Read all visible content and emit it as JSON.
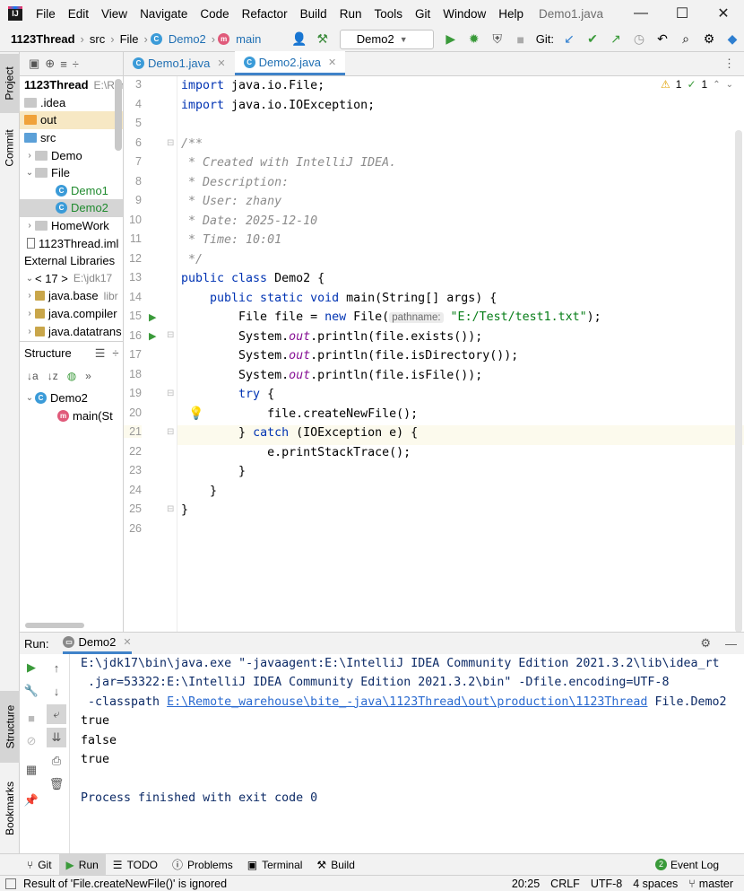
{
  "menubar": {
    "items": [
      "File",
      "Edit",
      "View",
      "Navigate",
      "Code",
      "Refactor",
      "Build",
      "Run",
      "Tools",
      "Git",
      "Window",
      "Help"
    ],
    "title": "Demo1.java"
  },
  "navbar": {
    "crumbs": [
      "1123Thread",
      "src",
      "File",
      "Demo2",
      "main"
    ],
    "run_config": "Demo2",
    "git_label": "Git:"
  },
  "side_tabs": {
    "project": "Project",
    "commit": "Commit",
    "structure": "Structure",
    "bookmarks": "Bookmarks"
  },
  "project_tree": {
    "rows": [
      {
        "label": "1123Thread",
        "extra": "E:\\Ren",
        "kind": "root"
      },
      {
        "label": ".idea",
        "kind": "folder-grey"
      },
      {
        "label": "out",
        "kind": "folder-orange"
      },
      {
        "label": "src",
        "kind": "folder-blue"
      },
      {
        "label": "Demo",
        "kind": "folder-grey"
      },
      {
        "label": "File",
        "kind": "folder-grey"
      },
      {
        "label": "Demo1",
        "kind": "class"
      },
      {
        "label": "Demo2",
        "kind": "class"
      },
      {
        "label": "HomeWork",
        "kind": "folder-grey"
      },
      {
        "label": "1123Thread.iml",
        "kind": "file"
      },
      {
        "label": "External Libraries",
        "kind": "lib"
      },
      {
        "label": "< 17 >",
        "extra": "E:\\jdk17",
        "kind": "lib"
      },
      {
        "label": "java.base",
        "extra": "libr",
        "kind": "jar"
      },
      {
        "label": "java.compiler",
        "kind": "jar"
      },
      {
        "label": "java.datatrans",
        "kind": "jar"
      }
    ]
  },
  "structure": {
    "title": "Structure",
    "class_name": "Demo2",
    "method": "main(St"
  },
  "editor": {
    "tabs": [
      "Demo1.java",
      "Demo2.java"
    ],
    "warnings": "1",
    "checks": "1",
    "line_numbers": [
      "3",
      "4",
      "5",
      "6",
      "7",
      "8",
      "9",
      "10",
      "11",
      "12",
      "13",
      "14",
      "15",
      "16",
      "17",
      "18",
      "19",
      "20",
      "21",
      "22",
      "23",
      "24",
      "25",
      "26"
    ],
    "lines": {
      "l3a": "import",
      "l3b": " java.io.File;",
      "l4a": "import",
      "l4b": " java.io.IOException;",
      "l6": "/**",
      "l7": " * Created with IntelliJ IDEA.",
      "l8": " * Description:",
      "l9": " * User: zhany",
      "l10": " * Date: 2025-12-10",
      "l11": " * Time: 10:01",
      "l12": " */",
      "l13a": "public class",
      "l13b": " Demo2 {",
      "l14a": "    public static void",
      "l14b": " main(String[] args) {",
      "l15a": "        File file = ",
      "l15b": "new",
      "l15c": " File(",
      "l15hint": "pathname:",
      "l15d": " \"E:/Test/test1.txt\"",
      "l15e": ");",
      "l16a": "        System.",
      "l16b": "out",
      "l16c": ".println(file.exists());",
      "l17a": "        System.",
      "l17b": "out",
      "l17c": ".println(file.isDirectory());",
      "l18a": "        System.",
      "l18b": "out",
      "l18c": ".println(file.isFile());",
      "l19a": "        try",
      "l19b": " {",
      "l20": "            file.createNewFile();",
      "l21a": "        } ",
      "l21b": "catch",
      "l21c": " (IOException e) {",
      "l22": "            e.printStackTrace();",
      "l23": "        }",
      "l24": "    }",
      "l25": "}"
    }
  },
  "run_panel": {
    "label": "Run:",
    "tab": "Demo2",
    "console": {
      "line1": "E:\\jdk17\\bin\\java.exe \"-javaagent:E:\\IntelliJ IDEA Community Edition 2021.3.2\\lib\\idea_rt",
      "line2": " .jar=53322:E:\\IntelliJ IDEA Community Edition 2021.3.2\\bin\" -Dfile.encoding=UTF-8",
      "line3a": " -classpath ",
      "line3b": "E:\\Remote_warehouse\\bite_-java\\1123Thread\\out\\production\\1123Thread",
      "line3c": " File.Demo2",
      "out1": "true",
      "out2": "false",
      "out3": "true",
      "exit": "Process finished with exit code 0"
    }
  },
  "bottom_tabs": [
    "Git",
    "Run",
    "TODO",
    "Problems",
    "Terminal",
    "Build"
  ],
  "event_log": {
    "count": "2",
    "label": "Event Log"
  },
  "status": {
    "message": "Result of 'File.createNewFile()' is ignored",
    "position": "20:25",
    "line_sep": "CRLF",
    "encoding": "UTF-8",
    "indent": "4 spaces",
    "branch": "master"
  }
}
